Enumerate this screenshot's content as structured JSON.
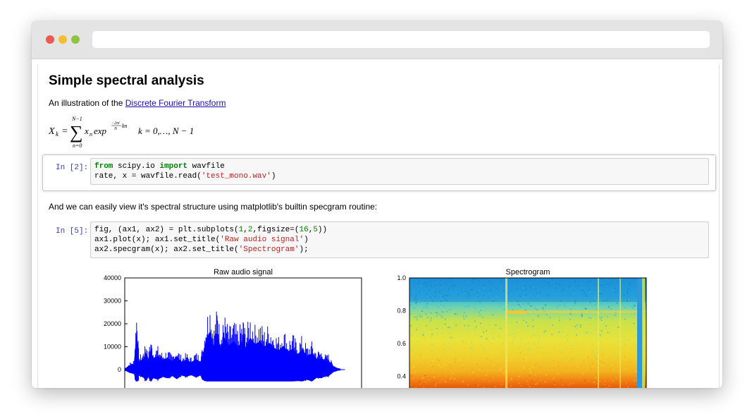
{
  "window": {
    "url": ""
  },
  "notebook": {
    "heading": "Simple spectral analysis",
    "intro_prefix": "An illustration of the ",
    "intro_link": "Discrete Fourier Transform",
    "formula": {
      "lhs": "X",
      "lhs_sub": "k",
      "sum_top": "N−1",
      "sum_bottom": "n=0",
      "term": "x",
      "term_sub": "n",
      "exp": "exp",
      "exp_sup": "−2πi",
      "exp_den": "N",
      "exp_kn": "kn",
      "range": "k = 0,…, N − 1"
    },
    "cell1": {
      "prompt": "In [2]:",
      "line1": {
        "kw1": "from",
        "mod": " scipy.io ",
        "kw2": "import",
        "name": " wavfile"
      },
      "line2": {
        "pre": "rate, x = wavfile.read(",
        "str": "'test_mono.wav'",
        "post": ")"
      }
    },
    "markdown2": "And we can easily view it's spectral structure using matplotlib's builtin specgram routine:",
    "cell2": {
      "prompt": "In [5]:",
      "line1": {
        "a": "fig, (ax1, ax2) = plt.subplots(",
        "n1": "1",
        "c1": ",",
        "n2": "2",
        "b": ",figsize=(",
        "n3": "16",
        "c2": ",",
        "n4": "5",
        "e": "))"
      },
      "line2": {
        "a": "ax1.plot(x); ax1.set_title(",
        "str": "'Raw audio signal'",
        "e": ")"
      },
      "line3": {
        "a": "ax2.specgram(x); ax2.set_title(",
        "str": "'Spectrogram'",
        "e": ");"
      }
    }
  },
  "chart_data": [
    {
      "type": "line",
      "title": "Raw audio signal",
      "ylim": [
        -5000,
        40000
      ],
      "yticks": [
        0,
        10000,
        20000,
        30000,
        40000
      ],
      "ytick_labels": [
        "0",
        "10000",
        "20000",
        "30000",
        "40000"
      ],
      "color": "#0000ff",
      "envelope": [
        [
          0.0,
          500
        ],
        [
          0.02,
          3000
        ],
        [
          0.04,
          4500
        ],
        [
          0.05,
          27000
        ],
        [
          0.06,
          6000
        ],
        [
          0.08,
          8500
        ],
        [
          0.09,
          12000
        ],
        [
          0.1,
          7000
        ],
        [
          0.11,
          14000
        ],
        [
          0.12,
          9000
        ],
        [
          0.14,
          10500
        ],
        [
          0.16,
          7500
        ],
        [
          0.18,
          9000
        ],
        [
          0.2,
          6500
        ],
        [
          0.22,
          10000
        ],
        [
          0.24,
          6000
        ],
        [
          0.26,
          7500
        ],
        [
          0.28,
          5500
        ],
        [
          0.3,
          8000
        ],
        [
          0.32,
          6000
        ],
        [
          0.33,
          11000
        ],
        [
          0.345,
          24000
        ],
        [
          0.36,
          30000
        ],
        [
          0.375,
          18000
        ],
        [
          0.39,
          28000
        ],
        [
          0.4,
          20000
        ],
        [
          0.41,
          16000
        ],
        [
          0.42,
          25000
        ],
        [
          0.44,
          19000
        ],
        [
          0.46,
          22000
        ],
        [
          0.48,
          18000
        ],
        [
          0.5,
          24000
        ],
        [
          0.51,
          17000
        ],
        [
          0.53,
          25000
        ],
        [
          0.55,
          20000
        ],
        [
          0.57,
          22000
        ],
        [
          0.59,
          18000
        ],
        [
          0.61,
          21000
        ],
        [
          0.63,
          17000
        ],
        [
          0.65,
          15000
        ],
        [
          0.67,
          18500
        ],
        [
          0.69,
          14000
        ],
        [
          0.71,
          16000
        ],
        [
          0.73,
          12000
        ],
        [
          0.75,
          15500
        ],
        [
          0.77,
          10500
        ],
        [
          0.79,
          12500
        ],
        [
          0.81,
          8500
        ],
        [
          0.83,
          9000
        ],
        [
          0.85,
          6500
        ],
        [
          0.86,
          7000
        ],
        [
          0.87,
          4500
        ],
        [
          0.88,
          2500
        ],
        [
          0.9,
          800
        ],
        [
          0.91,
          500
        ]
      ]
    },
    {
      "type": "heatmap",
      "title": "Spectrogram",
      "ylim": [
        0,
        1.0
      ],
      "yticks": [
        0.4,
        0.6,
        0.8,
        1.0
      ],
      "ytick_labels": [
        "0.4",
        "0.6",
        "0.8",
        "1.0"
      ],
      "colormap": "jet"
    }
  ]
}
